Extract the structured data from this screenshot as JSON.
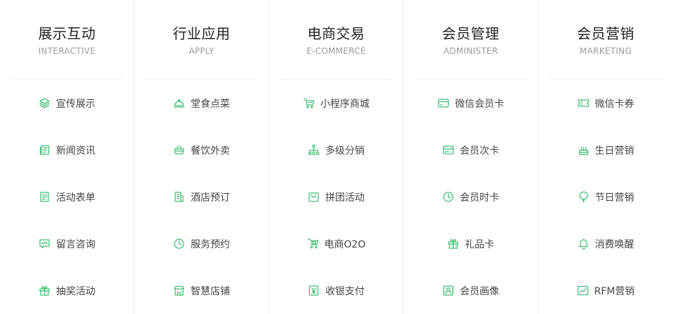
{
  "accent": "#3fbf74",
  "columns": [
    {
      "title": "展示互动",
      "subtitle": "INTERACTIVE",
      "items": [
        {
          "label": "宣传展示",
          "icon": "layers-icon"
        },
        {
          "label": "新闻资讯",
          "icon": "newspaper-icon"
        },
        {
          "label": "活动表单",
          "icon": "form-icon"
        },
        {
          "label": "留言咨询",
          "icon": "message-icon"
        },
        {
          "label": "抽奖活动",
          "icon": "gift-box-icon"
        }
      ]
    },
    {
      "title": "行业应用",
      "subtitle": "APPLY",
      "items": [
        {
          "label": "堂食点菜",
          "icon": "dish-cover-icon"
        },
        {
          "label": "餐饮外卖",
          "icon": "basket-icon"
        },
        {
          "label": "酒店预订",
          "icon": "building-icon"
        },
        {
          "label": "服务预约",
          "icon": "clock-icon"
        },
        {
          "label": "智慧店铺",
          "icon": "store-icon"
        }
      ]
    },
    {
      "title": "电商交易",
      "subtitle": "E-COMMERCE",
      "items": [
        {
          "label": "小程序商城",
          "icon": "cart-icon"
        },
        {
          "label": "多级分销",
          "icon": "hierarchy-icon"
        },
        {
          "label": "拼团活动",
          "icon": "bag-icon"
        },
        {
          "label": "电商O2O",
          "icon": "cart-screen-icon"
        },
        {
          "label": "收银支付",
          "icon": "yuan-icon"
        }
      ]
    },
    {
      "title": "会员管理",
      "subtitle": "ADMINISTER",
      "items": [
        {
          "label": "微信会员卡",
          "icon": "card-icon"
        },
        {
          "label": "会员次卡",
          "icon": "card-stripe-icon"
        },
        {
          "label": "会员时卡",
          "icon": "clock-icon"
        },
        {
          "label": "礼品卡",
          "icon": "gift-box-icon"
        },
        {
          "label": "会员画像",
          "icon": "portrait-icon"
        }
      ]
    },
    {
      "title": "会员营销",
      "subtitle": "MARKETING",
      "items": [
        {
          "label": "微信卡券",
          "icon": "ticket-icon"
        },
        {
          "label": "生日营销",
          "icon": "cake-icon"
        },
        {
          "label": "节日营销",
          "icon": "balloon-icon"
        },
        {
          "label": "消费唤醒",
          "icon": "bell-icon"
        },
        {
          "label": "RFM营销",
          "icon": "chart-icon"
        }
      ]
    }
  ]
}
